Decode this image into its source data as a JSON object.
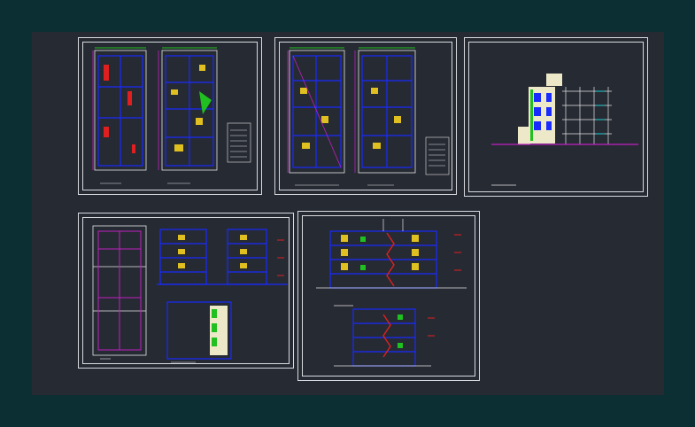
{
  "workspace": {
    "colors": {
      "outer_background": "#0c2f33",
      "model_space": "#262a33",
      "sheet_border": "#d8dadf",
      "line_blue": "#1a2bff",
      "line_white": "#e6e6e6",
      "line_magenta": "#c020c0",
      "line_green": "#20c020",
      "line_red": "#e02020",
      "line_yellow": "#e0c020",
      "line_cyan": "#20d0d0",
      "facade_fill": "#ece8c8"
    }
  },
  "sheets": [
    {
      "id": "sheet-1",
      "content": "floor-plans",
      "icon": "floor-plan-icon"
    },
    {
      "id": "sheet-2",
      "content": "floor-plans",
      "icon": "floor-plan-icon"
    },
    {
      "id": "sheet-3",
      "content": "elevation",
      "icon": "elevation-icon"
    },
    {
      "id": "sheet-4",
      "content": "plan-and-sections",
      "icon": "section-icon"
    },
    {
      "id": "sheet-5",
      "content": "sections",
      "icon": "section-icon"
    }
  ]
}
